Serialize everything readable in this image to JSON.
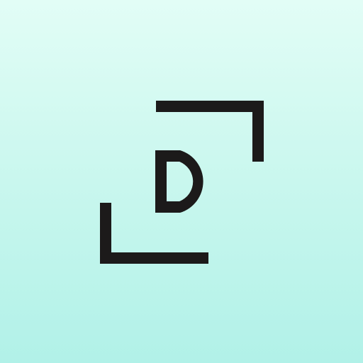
{
  "app_icon": {
    "logo_letter": "D",
    "logo_icon": "bracketed-letter-logo-icon",
    "colors": {
      "background_top": "#e2fdf6",
      "background_bottom": "#b1f1e8",
      "ink": "#1c1a1a"
    }
  }
}
